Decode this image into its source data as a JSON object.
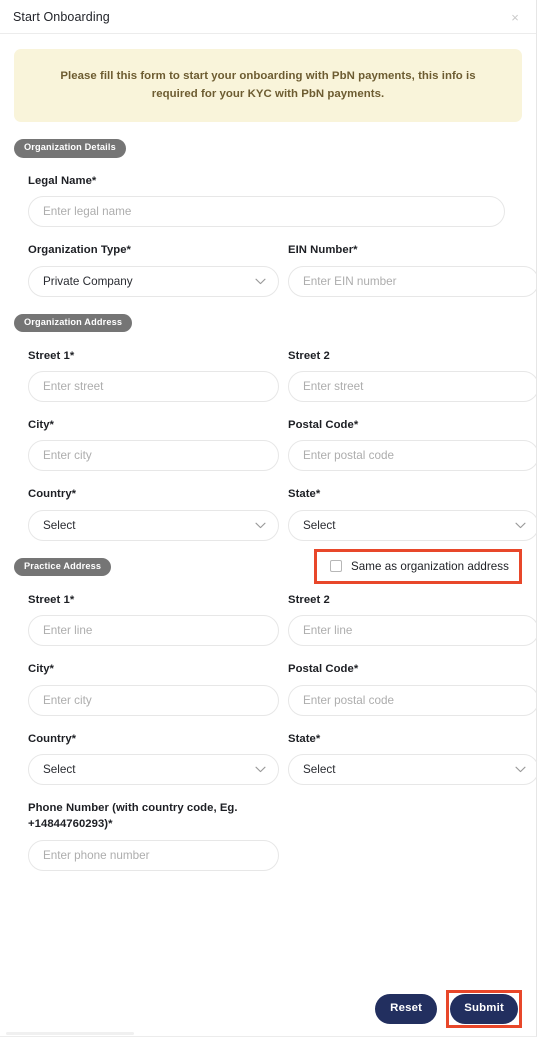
{
  "header": {
    "title": "Start Onboarding",
    "close_icon": "close-icon",
    "close_glyph": "×"
  },
  "notice": {
    "text": "Please fill this form to start your onboarding with PbN payments, this info is required for your KYC with PbN payments."
  },
  "sections": {
    "organization_details": {
      "pill": "Organization Details",
      "legal_name": {
        "label": "Legal Name*",
        "placeholder": "Enter legal name",
        "value": ""
      },
      "organization_type": {
        "label": "Organization Type*",
        "selected": "Private Company",
        "options": [
          "Private Company"
        ]
      },
      "ein_number": {
        "label": "EIN Number*",
        "placeholder": "Enter EIN number",
        "value": ""
      }
    },
    "organization_address": {
      "pill": "Organization Address",
      "street1": {
        "label": "Street 1*",
        "placeholder": "Enter street",
        "value": ""
      },
      "street2": {
        "label": "Street 2",
        "placeholder": "Enter street",
        "value": ""
      },
      "city": {
        "label": "City*",
        "placeholder": "Enter city",
        "value": ""
      },
      "postal_code": {
        "label": "Postal Code*",
        "placeholder": "Enter postal code",
        "value": ""
      },
      "country": {
        "label": "Country*",
        "selected": "Select",
        "options": [
          "Select"
        ]
      },
      "state": {
        "label": "State*",
        "selected": "Select",
        "options": [
          "Select"
        ]
      }
    },
    "practice_address": {
      "pill": "Practice Address",
      "same_as_org": {
        "label": "Same as organization address",
        "checked": false,
        "highlight_color": "#e8472a"
      },
      "street1": {
        "label": "Street 1*",
        "placeholder": "Enter line",
        "value": ""
      },
      "street2": {
        "label": "Street 2",
        "placeholder": "Enter line",
        "value": ""
      },
      "city": {
        "label": "City*",
        "placeholder": "Enter city",
        "value": ""
      },
      "postal_code": {
        "label": "Postal Code*",
        "placeholder": "Enter postal code",
        "value": ""
      },
      "country": {
        "label": "Country*",
        "selected": "Select",
        "options": [
          "Select"
        ]
      },
      "state": {
        "label": "State*",
        "selected": "Select",
        "options": [
          "Select"
        ]
      },
      "phone": {
        "label": "Phone Number (with country code, Eg. +14844760293)*",
        "placeholder": "Enter phone number",
        "value": ""
      }
    }
  },
  "footer": {
    "reset_label": "Reset",
    "submit_label": "Submit",
    "button_color": "#222f5f",
    "submit_highlight_color": "#e8472a"
  },
  "theme": {
    "pill_bg": "#757575",
    "notice_bg": "#f9f4da",
    "notice_text": "#6d5c31",
    "border": "#e7e7e7"
  }
}
